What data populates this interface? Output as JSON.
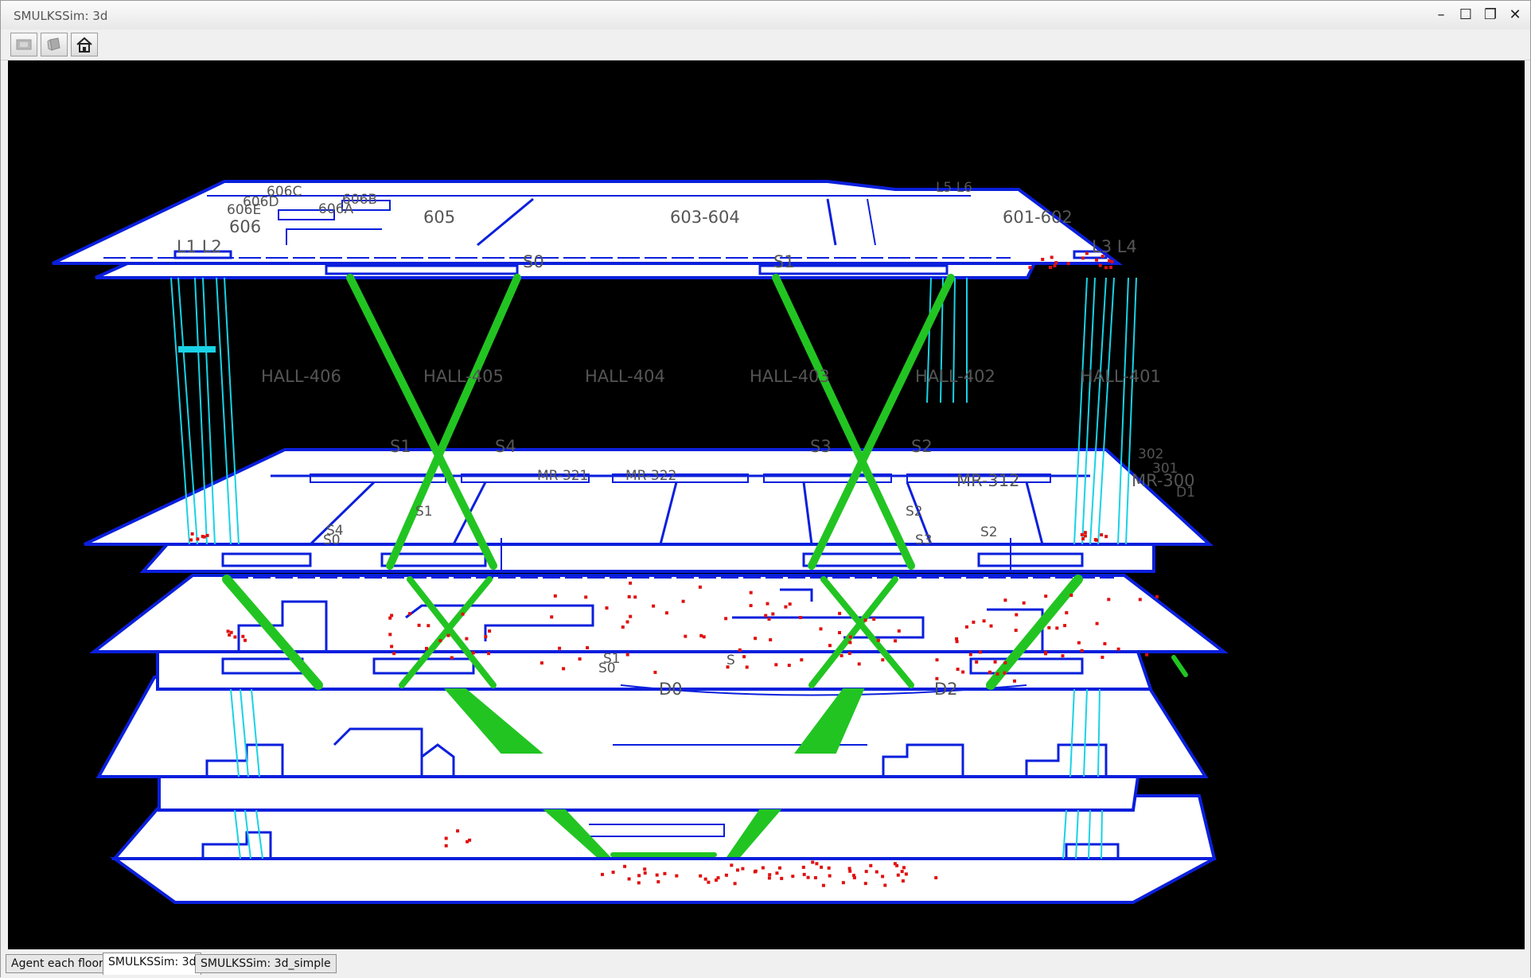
{
  "window": {
    "title": "SMULKSSim: 3d",
    "controls": {
      "minimize": "–",
      "maximize": "☐",
      "restore": "❐",
      "close": "✕"
    }
  },
  "toolbar": {
    "buttons": [
      {
        "icon": "image-icon",
        "enabled": false
      },
      {
        "icon": "cube-icon",
        "enabled": false
      },
      {
        "icon": "home-icon",
        "enabled": true
      }
    ]
  },
  "tabs": [
    {
      "label": "Agent each floor",
      "active": false
    },
    {
      "label": "SMULKSSim: 3d",
      "active": true
    },
    {
      "label": "SMULKSSim: 3d_simple",
      "active": false
    }
  ],
  "colors": {
    "background": "#000000",
    "floor_fill": "#ffffff",
    "floor_outline": "#0a1fdc",
    "lift": "#19d2e6",
    "stairs": "#22c422",
    "agent": "#e01010",
    "label": "#555555"
  },
  "floors": {
    "f6": {
      "rooms": [
        "606C",
        "606D",
        "606E",
        "606B",
        "606A",
        "606",
        "605",
        "603-604",
        "601-602"
      ],
      "lifts": [
        "L1 L2",
        "L3 L4",
        "L5 L6"
      ],
      "stairs": [
        "S0",
        "S1"
      ]
    },
    "f4": {
      "rooms": [
        "HALL-406",
        "HALL-405",
        "HALL-404",
        "HALL-403",
        "HALL-402",
        "HALL-401"
      ],
      "stairs": [
        "S1",
        "S4",
        "S3",
        "S2"
      ]
    },
    "f3": {
      "rooms": [
        "MR-321",
        "MR-322",
        "MR-312",
        "MR-300",
        "302",
        "301"
      ],
      "stairs": [
        "S4",
        "S0",
        "S1",
        "S2",
        "S3",
        "S2"
      ],
      "exits": [
        "D1"
      ]
    },
    "f1": {
      "stairs": [
        "S1",
        "S0",
        "S"
      ],
      "exits": [
        "D0",
        "D2"
      ]
    }
  }
}
